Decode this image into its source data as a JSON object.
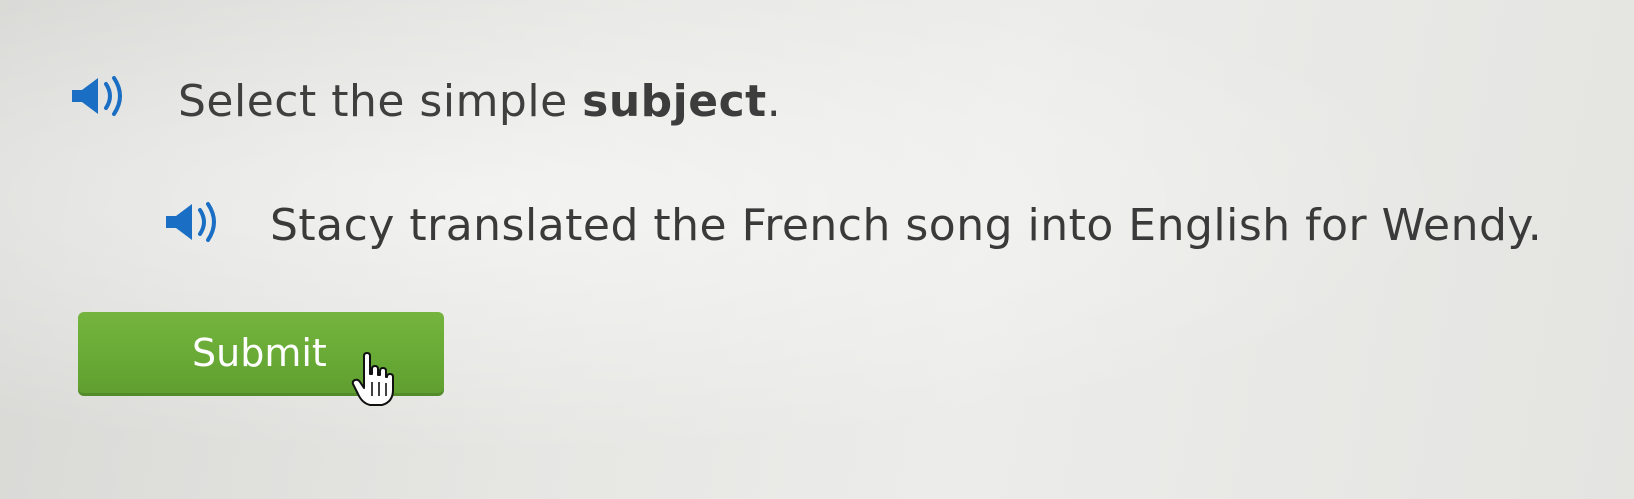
{
  "question": {
    "prompt_prefix": "Select the simple ",
    "prompt_keyword": "subject",
    "prompt_suffix": ".",
    "prompt_audio_icon": "speaker-icon"
  },
  "sentence": {
    "text": "Stacy translated the French song into English for Wendy.",
    "audio_icon": "speaker-icon"
  },
  "actions": {
    "submit_label": "Submit"
  },
  "cursor": {
    "icon": "hand-pointer-icon"
  },
  "colors": {
    "speaker_blue": "#1a6fc4",
    "submit_green": "#6aab37",
    "text_gray": "#3f3f3f"
  }
}
